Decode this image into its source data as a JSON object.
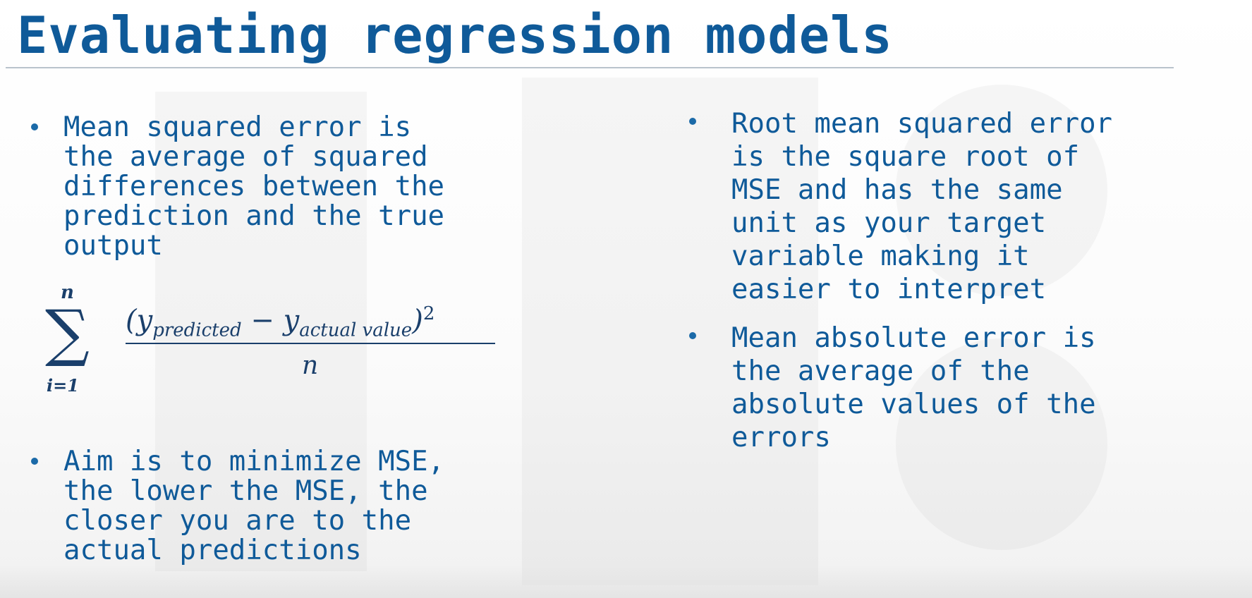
{
  "slide": {
    "title": "Evaluating regression models",
    "left_bullets": [
      {
        "text": "Mean squared error is\nthe average of squared\ndifferences between the\nprediction and the true\noutput"
      },
      {
        "text": "Aim is to minimize MSE,\nthe lower the MSE, the\ncloser you are to the\nactual predictions"
      }
    ],
    "right_bullets": [
      {
        "text": "Root mean squared error\nis the square root of\nMSE and has the same\nunit as your target\nvariable making it\neasier to interpret"
      },
      {
        "text": "Mean absolute error is\nthe average of the\nabsolute values of the\nerrors"
      }
    ],
    "formula": {
      "sum_upper": "n",
      "sum_lower": "i=1",
      "numerator_open": "(y",
      "numerator_sub1": "predicted",
      "numerator_minus": " − y",
      "numerator_sub2": "actual value",
      "numerator_close": ")",
      "numerator_exp": "2",
      "denominator": "n"
    }
  },
  "colors": {
    "text_blue": "#0f5a99",
    "rule": "#b9c3cc",
    "formula": "#1a3f6b"
  }
}
